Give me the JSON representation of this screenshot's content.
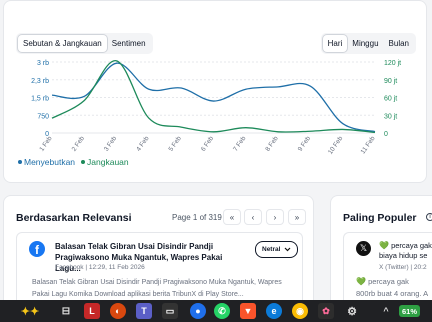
{
  "tabs_left": [
    "Sebutan & Jangkauan",
    "Sentimen"
  ],
  "tabs_right": [
    "Hari",
    "Minggu",
    "Bulan"
  ],
  "chart_data": {
    "type": "line",
    "x": [
      "1 Feb",
      "2 Feb",
      "3 Feb",
      "4 Feb",
      "5 Feb",
      "6 Feb",
      "7 Feb",
      "8 Feb",
      "9 Feb",
      "10 Feb",
      "11 Feb"
    ],
    "y_left_ticks": [
      "0",
      "750",
      "1,5 rb",
      "2,3 rb",
      "3 rb"
    ],
    "y_right_ticks": [
      "0",
      "30 jt",
      "60 jt",
      "90 jt",
      "120 jt"
    ],
    "ylim_left": [
      0,
      3000
    ],
    "ylim_right": [
      0,
      120
    ],
    "series": [
      {
        "name": "Menyebutkan",
        "color": "#1f6fa8",
        "axis": "left",
        "values": [
          1600,
          1550,
          2950,
          1850,
          1900,
          1350,
          1850,
          1950,
          1980,
          400,
          60
        ]
      },
      {
        "name": "Jangkauan",
        "color": "#1d8a5a",
        "axis": "right",
        "values": [
          25,
          55,
          122,
          25,
          10,
          2,
          9,
          2,
          3,
          6,
          1
        ]
      }
    ],
    "legend": "bottom-left"
  },
  "relevance": {
    "title": "Berdasarkan Relevansi",
    "page_info": "Page 1 of 319",
    "pagination": [
      "«",
      "‹",
      "›",
      "»"
    ],
    "post": {
      "title": "Balasan Telak Gibran Usai Disindir Pandji Pragiwaksono Muka Ngantuk, Wapres Pakai Lagu...",
      "meta": "Facebook | 12:29, 11 Feb 2026",
      "sentiment": "Netral",
      "body": "Balasan Telak Gibran Usai Disindir Pandji Pragiwaksono Muka Ngantuk, Wapres Pakai Lagu Komika Download aplikasi berita TribunX di Play Store..."
    }
  },
  "popular": {
    "title": "Paling Populer",
    "post": {
      "line1": "percaya gak",
      "line2": "biaya hidup se",
      "meta": "X (Twitter) | 20:2",
      "body1": "percaya gak",
      "body2": "800rb buat 4 orang. A"
    }
  },
  "taskbar": {
    "battery": "61%"
  }
}
